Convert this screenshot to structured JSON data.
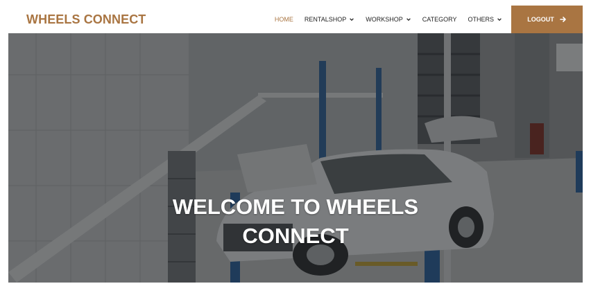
{
  "brand": {
    "name": "WHEELS CONNECT",
    "color": "#a97542"
  },
  "nav": {
    "items": [
      {
        "label": "HOME",
        "active": true,
        "dropdown": false
      },
      {
        "label": "RENTALSHOP",
        "active": false,
        "dropdown": true
      },
      {
        "label": "WORKSHOP",
        "active": false,
        "dropdown": true
      },
      {
        "label": "CATEGORY",
        "active": false,
        "dropdown": false
      },
      {
        "label": "OTHERS",
        "active": false,
        "dropdown": true
      }
    ],
    "logout_label": "LOGOUT",
    "logout_icon": "arrow-right-icon"
  },
  "hero": {
    "title_line1": "WELCOME TO WHEELS",
    "title_line2": "CONNECT",
    "background": "garage-workshop-photo"
  }
}
